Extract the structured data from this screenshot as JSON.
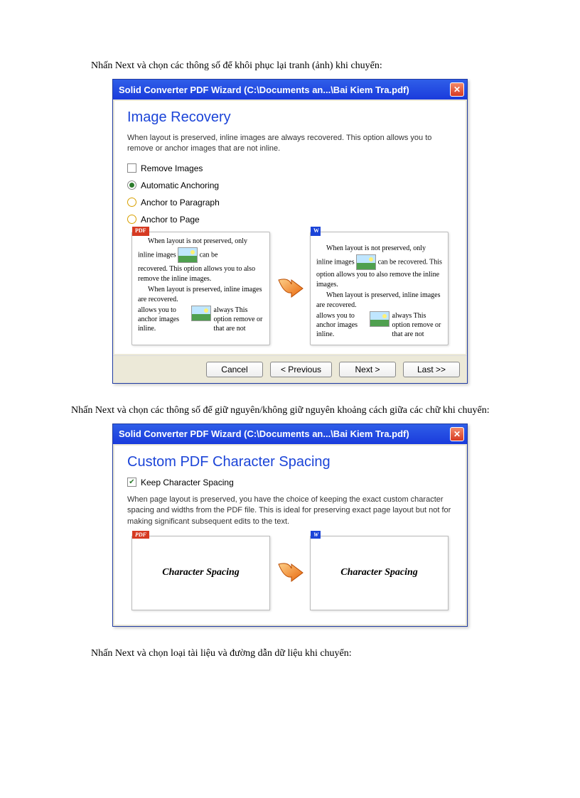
{
  "instr1": "Nhấn Next và chọn các thông số để khôi phục lại tranh (ảnh) khi chuyển:",
  "instr2": "Nhấn Next và  chọn các thông số để giữ nguyên/không  giữ nguyên khoảng  cách giữa các chữ khi chuyển:",
  "instr3": "Nhấn Next và chọn loại tài liệu và đường dẫn dữ liệu khi chuyển:",
  "dialog1": {
    "title": "Solid Converter PDF Wizard (C:\\Documents an...\\Bai Kiem Tra.pdf)",
    "heading": "Image Recovery",
    "desc": "When layout is preserved, inline images are always recovered. This option allows you to remove or anchor images that are not inline.",
    "options": {
      "remove": "Remove Images",
      "auto": "Automatic Anchoring",
      "para": "Anchor to Paragraph",
      "page": "Anchor to Page"
    },
    "preview": {
      "pdf_label": "PDF",
      "w_label": "W",
      "line1": "When layout is not preserved, only",
      "line2a": "inline images",
      "line2b": "can be",
      "line3": "recovered. This option allows you to also remove the inline images.",
      "line4": "When layout is preserved, inline images are recovered.",
      "col_a": "allows you to anchor images inline.",
      "col_b": "always This option remove or that are not",
      "r_line2b": "can be recovered. This option allows you to also remove the inline images.",
      "r_line4": "When layout is preserved, inline images are recovered."
    },
    "buttons": {
      "cancel": "Cancel",
      "prev": "< Previous",
      "next": "Next >",
      "last": "Last >>"
    }
  },
  "dialog2": {
    "title": "Solid Converter PDF Wizard (C:\\Documents an...\\Bai Kiem Tra.pdf)",
    "heading": "Custom PDF Character Spacing",
    "check": "Keep Character Spacing",
    "desc": "When page layout is preserved, you have the choice of keeping the exact custom character spacing and widths from the PDF file. This is ideal for preserving exact page layout but not for making significant subsequent edits to the text.",
    "preview_text": "Character Spacing",
    "pdf_label": "PDF",
    "w_label": "W"
  }
}
